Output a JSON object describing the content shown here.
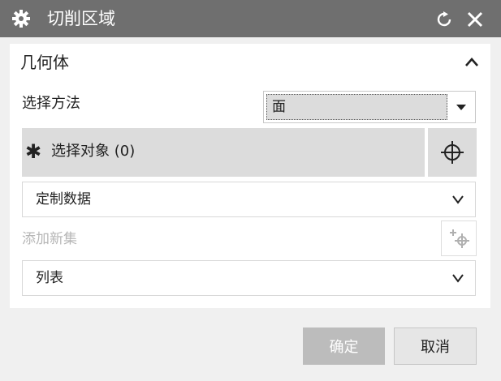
{
  "window": {
    "title": "切削区域",
    "icons": [
      "gear-icon",
      "refresh-icon",
      "close-icon"
    ]
  },
  "geometry_section": {
    "title": "几何体",
    "toggle_icon": "chevron-up-icon",
    "method_label": "选择方法",
    "method_value": "面",
    "select_object_label": "选择对象 (0)",
    "custom_data_label": "定制数据",
    "add_new_set_label": "添加新集",
    "list_label": "列表"
  },
  "footer": {
    "ok_label": "确定",
    "cancel_label": "取消"
  },
  "colors": {
    "titlebar": "#6f6f6f",
    "panel": "#ffffff",
    "row_highlight": "#dcdcdc",
    "disabled_text": "#b6b6b6"
  }
}
